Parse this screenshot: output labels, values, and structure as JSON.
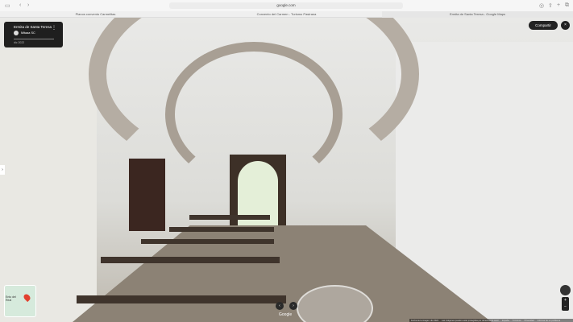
{
  "browser": {
    "url": "google.com",
    "tabs": [
      {
        "label": "Planos convento Carmelitas"
      },
      {
        "label": "Convento del Carmen - Turismo Pastrana"
      },
      {
        "label": "Ermita de Santa Teresa - Google Maps"
      }
    ]
  },
  "card": {
    "title": "Ermita de Santa Teresa",
    "user": "Mitaaa SC",
    "date": "dic 2022"
  },
  "controls": {
    "share": "Compartir",
    "close": "×",
    "zoom_in": "+",
    "zoom_out": "−",
    "prev": "‹",
    "next": "›",
    "left": "›"
  },
  "minimap": {
    "label": "Ento del Real"
  },
  "logo": "Google",
  "footer": {
    "date": "Fecha de la imagen: dic 2022",
    "copyright": "Las imágenes pueden estar protegidas por derechos de autor",
    "region": "España",
    "terms": "Términos",
    "privacy": "Privacidad",
    "report": "Informar de un problema"
  }
}
